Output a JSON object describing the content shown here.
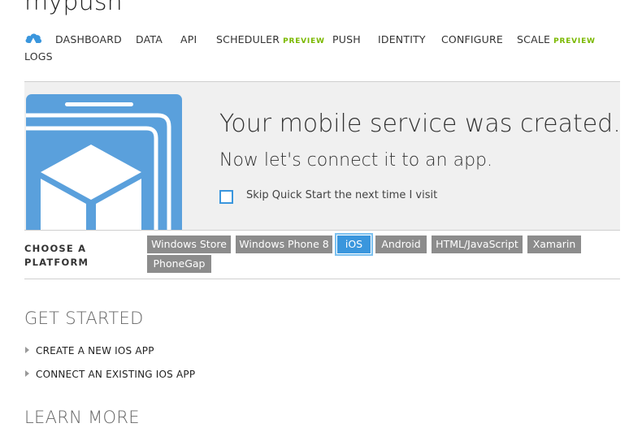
{
  "service": {
    "name": "mypush"
  },
  "nav": {
    "icon": "cloud-icon",
    "items": [
      {
        "label": "DASHBOARD",
        "badge": ""
      },
      {
        "label": "DATA",
        "badge": ""
      },
      {
        "label": "API",
        "badge": ""
      },
      {
        "label": "SCHEDULER",
        "badge": "PREVIEW"
      },
      {
        "label": "PUSH",
        "badge": ""
      },
      {
        "label": "IDENTITY",
        "badge": ""
      },
      {
        "label": "CONFIGURE",
        "badge": ""
      },
      {
        "label": "SCALE",
        "badge": "PREVIEW"
      },
      {
        "label": "LOGS",
        "badge": ""
      }
    ]
  },
  "banner": {
    "title": "Your mobile service was created.",
    "subtitle": "Now let's connect it to an app.",
    "skip_label": "Skip Quick Start the next time I visit",
    "skip_checked": false
  },
  "platforms": {
    "label_line1": "CHOOSE A",
    "label_line2": "PLATFORM",
    "options": [
      "Windows Store",
      "Windows Phone 8",
      "iOS",
      "Android",
      "HTML/JavaScript",
      "Xamarin",
      "PhoneGap"
    ],
    "selected": "iOS"
  },
  "get_started": {
    "heading": "GET STARTED",
    "items": [
      "CREATE A NEW IOS APP",
      "CONNECT AN EXISTING IOS APP"
    ]
  },
  "learn_more": {
    "heading": "LEARN MORE"
  },
  "colors": {
    "accent": "#3a96dd",
    "preview": "#7ab800",
    "button_gray": "#8c8c8c",
    "banner_bg": "#f0f0f0"
  }
}
